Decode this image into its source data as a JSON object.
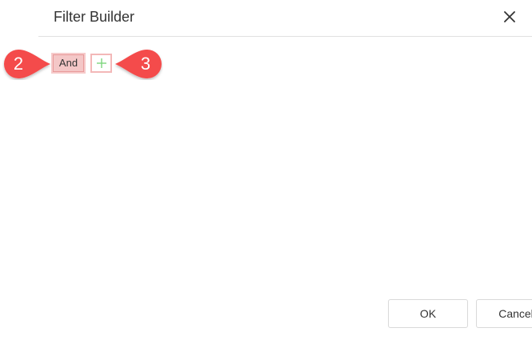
{
  "dialog": {
    "title": "Filter Builder",
    "close_icon": "close-icon"
  },
  "filter": {
    "group_operator": "And",
    "add_icon": "plus-icon"
  },
  "callouts": [
    {
      "label": "2",
      "color": "#f44b4b"
    },
    {
      "label": "3",
      "color": "#f44b4b"
    }
  ],
  "footer": {
    "ok_label": "OK",
    "cancel_label": "Cancel"
  },
  "colors": {
    "accent_callout": "#f44b4b",
    "group_highlight": "#f4c7c7",
    "add_plus": "#7cd67c"
  }
}
